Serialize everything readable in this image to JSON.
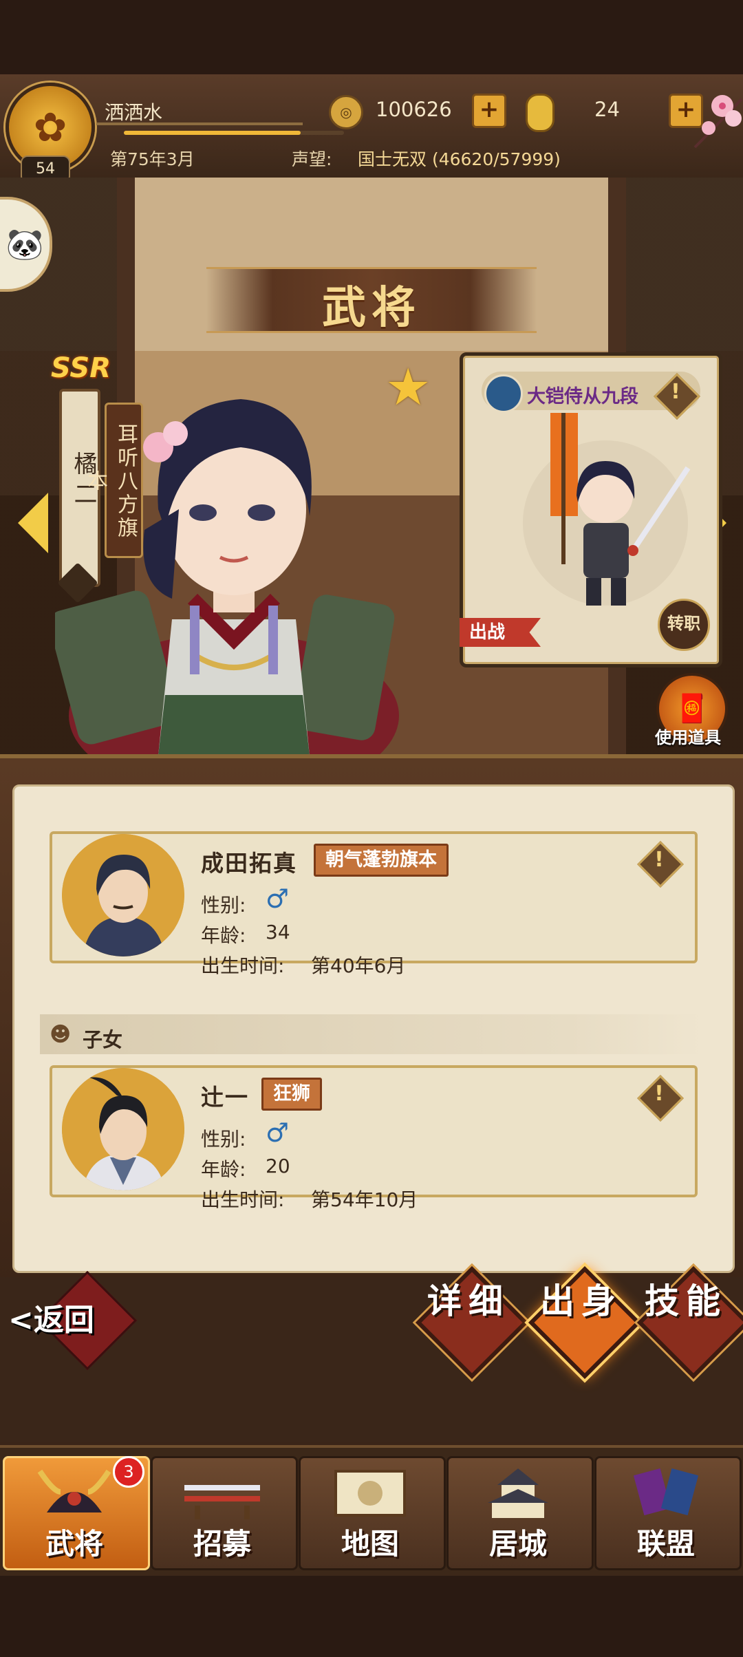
{
  "hud": {
    "emblem_glyph": "✿",
    "level": "54",
    "player_name": "洒洒水",
    "date": "第75年3月",
    "fame_label": "声望:",
    "fame_value": "国士无双 (46620/57999)",
    "fame_progress": 0.804,
    "coin_glyph": "◎",
    "coins": "100626",
    "koban": "24",
    "plus": "+"
  },
  "scene": {
    "title": "武将",
    "rarity": "SSR",
    "general_name": "橘二",
    "trait": "耳听八方旗本",
    "star": "★",
    "class_card": {
      "class_name": "大铠侍从九段",
      "warn": "!",
      "sortie": "出战",
      "change_job": "转职"
    },
    "use_item_label": "使用道具",
    "panda_glyph": "🐼"
  },
  "origin": {
    "spouse": {
      "name": "成田拓真",
      "tag": "朝气蓬勃旗本",
      "gender_label": "性别:",
      "gender_icon": "♂",
      "age_label": "年龄:",
      "age": "34",
      "birth_label": "出生时间:",
      "birth": "第40年6月"
    },
    "children_section": "子女",
    "child": {
      "name": "辻一",
      "tag": "狂狮",
      "gender_label": "性别:",
      "gender_icon": "♂",
      "age_label": "年龄:",
      "age": "20",
      "birth_label": "出生时间:",
      "birth": "第54年10月"
    },
    "warn": "!"
  },
  "actions": {
    "back": "<返回",
    "detail": "详细",
    "origin": "出身",
    "skills": "技能"
  },
  "nav": {
    "items": [
      {
        "label": "武将",
        "badge": "3"
      },
      {
        "label": "招募"
      },
      {
        "label": "地图"
      },
      {
        "label": "居城"
      },
      {
        "label": "联盟"
      }
    ]
  }
}
